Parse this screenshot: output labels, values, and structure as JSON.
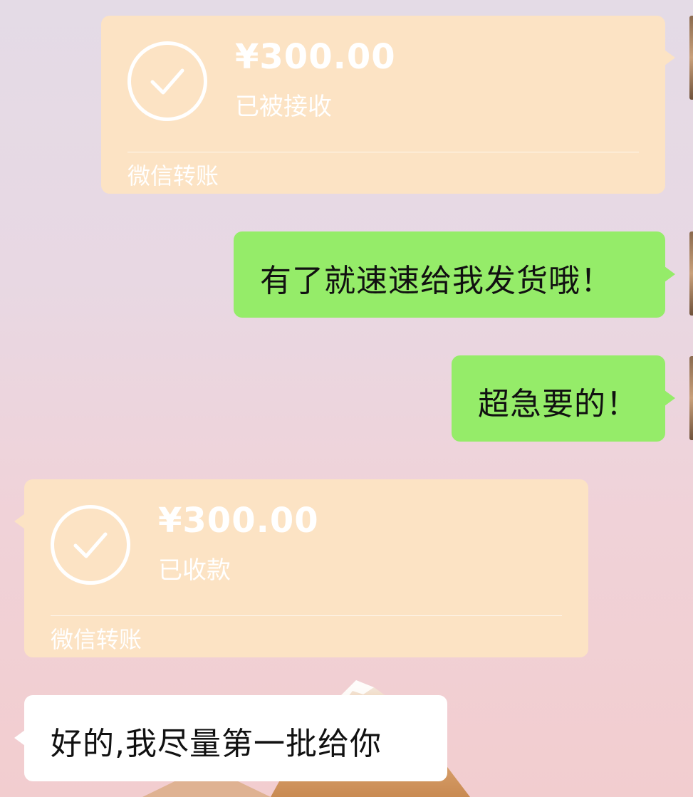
{
  "chat": {
    "messages": [
      {
        "type": "transfer",
        "direction": "sent",
        "amount": "¥300.00",
        "status": "已被接收",
        "footer": "微信转账"
      },
      {
        "type": "text",
        "direction": "sent",
        "text": "有了就速速给我发货哦！"
      },
      {
        "type": "text",
        "direction": "sent",
        "text": "超急要的！"
      },
      {
        "type": "transfer",
        "direction": "received",
        "amount": "¥300.00",
        "status": "已收款",
        "footer": "微信转账"
      },
      {
        "type": "text",
        "direction": "received",
        "text": "好的,我尽量第一批给你"
      }
    ]
  },
  "icons": {
    "transfer_status": "check-circle-icon"
  },
  "colors": {
    "sent_bubble": "#95ec69",
    "received_bubble": "#ffffff",
    "transfer_bubble": "#fce3c4",
    "transfer_text": "#ffffff"
  }
}
